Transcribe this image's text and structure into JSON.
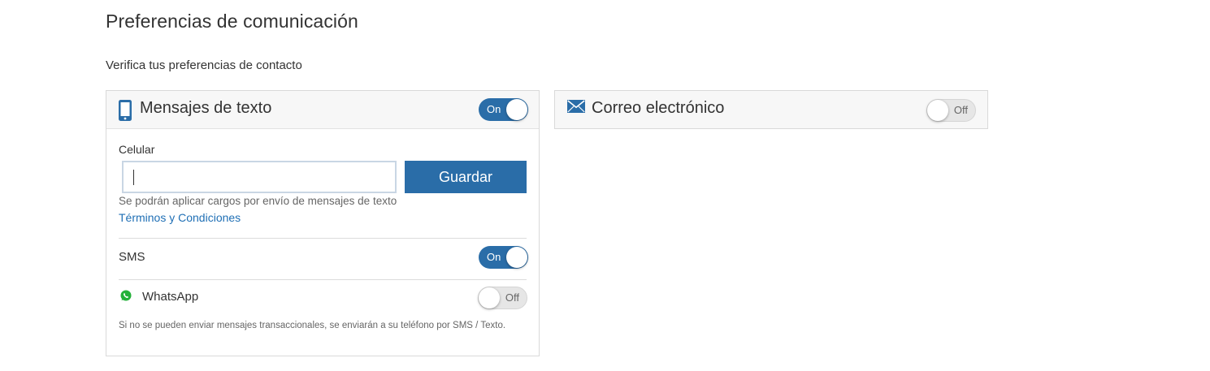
{
  "page": {
    "title": "Preferencias de comunicación",
    "subtitle": "Verifica tus preferencias de contacto"
  },
  "text_messages": {
    "title": "Mensajes de texto",
    "toggle": {
      "state": "on",
      "label": "On"
    },
    "phone_label": "Celular",
    "phone_value": "",
    "save_label": "Guardar",
    "charge_note": "Se podrán aplicar cargos por envío de mensajes de texto",
    "terms_link": "Términos y Condiciones",
    "sms": {
      "label": "SMS",
      "state": "on",
      "toggle_label": "On"
    },
    "whatsapp": {
      "label": "WhatsApp",
      "state": "off",
      "toggle_label": "Off"
    },
    "whatsapp_note": "Si no se pueden enviar mensajes transaccionales, se enviarán a su teléfono por SMS / Texto."
  },
  "email": {
    "title": "Correo electrónico",
    "toggle": {
      "state": "off",
      "label": "Off"
    }
  },
  "colors": {
    "accent": "#2a6da8",
    "link": "#1f6fb5",
    "whatsapp": "#25b13a"
  },
  "icons": {
    "text_messages": "mobile-phone-icon",
    "email": "envelope-icon",
    "whatsapp": "whatsapp-icon"
  }
}
